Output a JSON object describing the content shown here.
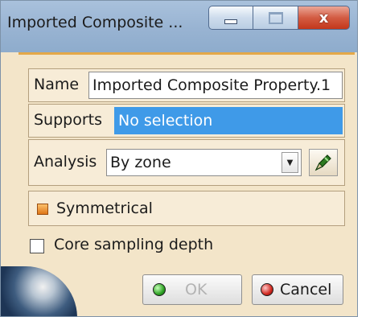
{
  "window": {
    "title": "Imported Composite ...",
    "controls": {
      "minimize": "minimize",
      "maximize": "maximize",
      "close": "x"
    }
  },
  "form": {
    "name": {
      "label": "Name",
      "value": "Imported Composite Property.1"
    },
    "supports": {
      "label": "Supports",
      "value": "No selection"
    },
    "analysis": {
      "label": "Analysis",
      "selected": "By zone"
    },
    "symmetrical": {
      "label": "Symmetrical",
      "checked": true
    },
    "core_sampling": {
      "label": "Core sampling depth",
      "checked": false
    }
  },
  "buttons": {
    "ok": {
      "label": "OK",
      "enabled": false
    },
    "cancel": {
      "label": "Cancel",
      "enabled": true
    }
  },
  "colors": {
    "panel_bg": "#f3e5c9",
    "selection": "#3f9ae8",
    "close_red": "#c3371b",
    "titlebar": "#98b3d2"
  },
  "icons": {
    "analysis_tool": "pencil-tool-icon",
    "ok_bullet": "green-bullet-icon",
    "cancel_bullet": "red-bullet-icon"
  }
}
